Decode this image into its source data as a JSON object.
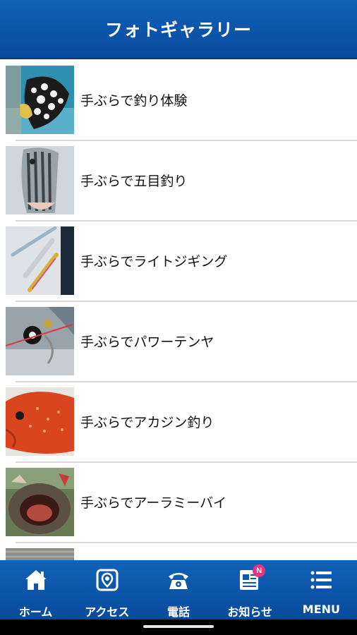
{
  "header": {
    "title": "フォトギャラリー"
  },
  "gallery": {
    "items": [
      {
        "label": "手ぶらで釣り体験",
        "photo": "triggerfish-photo"
      },
      {
        "label": "手ぶらで五目釣り",
        "photo": "striped-fish-photo"
      },
      {
        "label": "手ぶらでライトジギング",
        "photo": "jig-lures-photo"
      },
      {
        "label": "手ぶらでパワーテンヤ",
        "photo": "fishing-reel-photo"
      },
      {
        "label": "手ぶらでアカジン釣り",
        "photo": "red-grouper-photo"
      },
      {
        "label": "手ぶらでアーラミーバイ",
        "photo": "grouper-mouth-photo"
      },
      {
        "label": "",
        "photo": "partial-photo"
      }
    ]
  },
  "tabbar": {
    "items": [
      {
        "label": "ホーム",
        "icon": "home-icon"
      },
      {
        "label": "アクセス",
        "icon": "map-pin-icon"
      },
      {
        "label": "電話",
        "icon": "phone-icon"
      },
      {
        "label": "お知らせ",
        "icon": "news-icon",
        "badge": "N"
      },
      {
        "label": "MENU",
        "icon": "menu-icon"
      }
    ]
  },
  "colors": {
    "bar": "#0a4a9c",
    "badge": "#e8337d"
  }
}
